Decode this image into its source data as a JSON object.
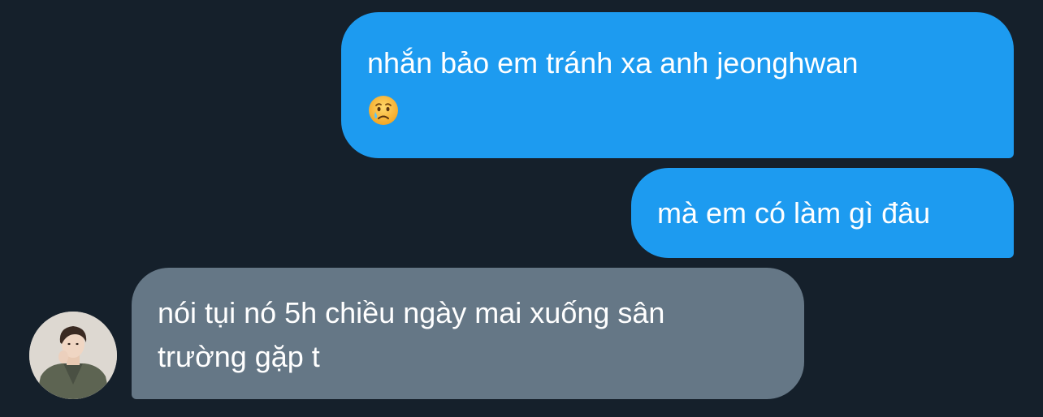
{
  "messages": [
    {
      "direction": "sent",
      "lines": [
        "nhắn bảo em tránh xa anh jeonghwan"
      ],
      "emoji": "crying-face-emoji"
    },
    {
      "direction": "sent",
      "lines": [
        "mà em có làm gì đâu"
      ]
    },
    {
      "direction": "received",
      "lines": [
        "nói tụi nó 5h chiều ngày mai xuống sân",
        "trường gặp t"
      ]
    }
  ],
  "colors": {
    "background": "#15202b",
    "sent_bubble": "#1d9bf0",
    "received_bubble": "#657786",
    "text": "#ffffff"
  },
  "avatar": {
    "icon": "profile-photo-avatar"
  }
}
